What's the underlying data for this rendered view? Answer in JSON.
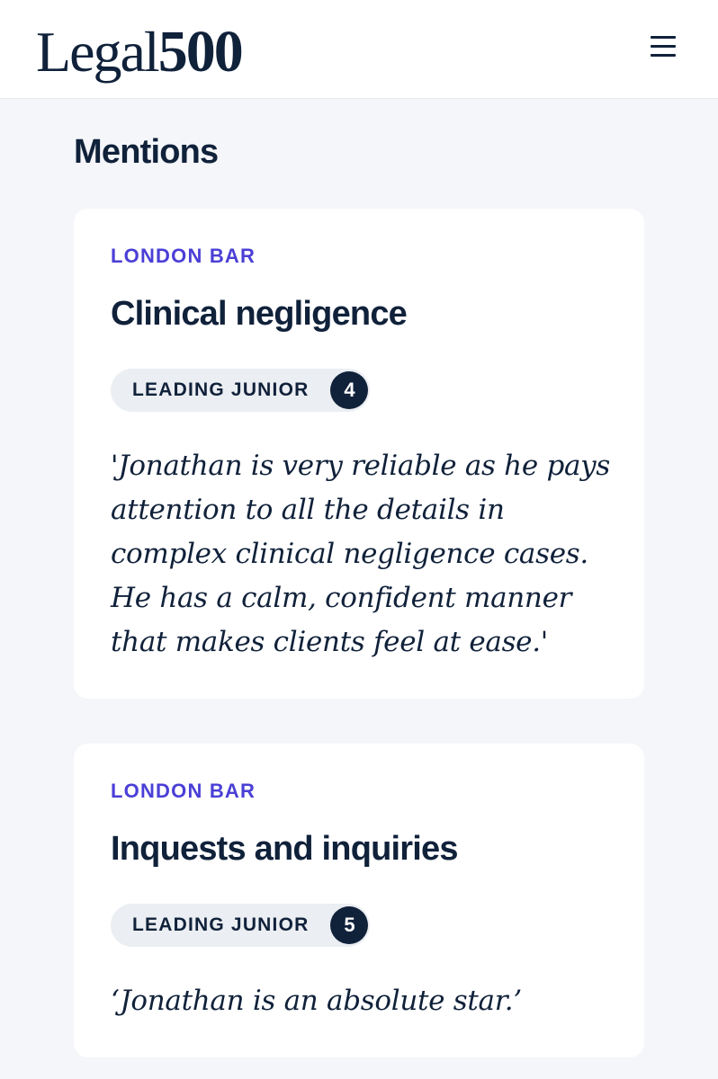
{
  "header": {
    "logo_word": "Legal",
    "logo_number": "500",
    "menu_icon": "hamburger-menu-icon"
  },
  "section": {
    "title": "Mentions"
  },
  "mentions": [
    {
      "category": "LONDON BAR",
      "practice_area": "Clinical negligence",
      "badge_label": "LEADING JUNIOR",
      "rank": "4",
      "quote": "'Jonathan is very reliable as he pays attention to all the details in complex clinical negligence cases. He has a calm, confident manner that makes clients feel at ease.'"
    },
    {
      "category": "LONDON BAR",
      "practice_area": "Inquests and inquiries",
      "badge_label": "LEADING JUNIOR",
      "rank": "5",
      "quote": "‘Jonathan is an absolute star.’"
    }
  ],
  "colors": {
    "navy": "#10213a",
    "accent": "#4a3fd6",
    "background": "#f4f6f9",
    "card": "#ffffff",
    "badge": "#ebeef2"
  }
}
